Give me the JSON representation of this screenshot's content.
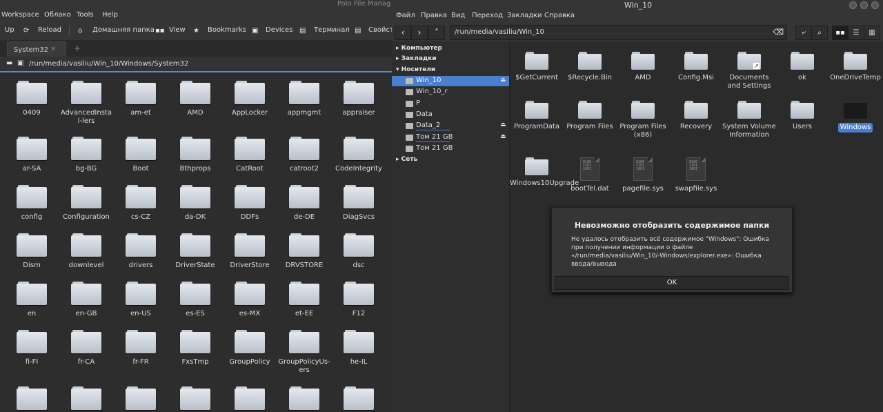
{
  "left_window": {
    "title": "Polo File Manag",
    "menu": [
      "Workspace",
      "Облако",
      "Tools",
      "Help"
    ],
    "toolbar": {
      "up": "Up",
      "reload": "Reload",
      "home": "Домашняя папка",
      "view": "View",
      "bookmarks": "Bookmarks",
      "devices": "Devices",
      "terminal": "Терминал",
      "properties": "Свойст"
    },
    "tab": {
      "label": "System32",
      "close": "✕",
      "new": "+"
    },
    "path": "/run/media/vasiliu/Win_10/Windows/System32",
    "folders": [
      "0409",
      "AdvancedInstal-lers",
      "am-et",
      "AMD",
      "AppLocker",
      "appmgmt",
      "appraiser",
      "ar-SA",
      "bg-BG",
      "Boot",
      "Bthprops",
      "CatRoot",
      "catroot2",
      "CodeIntegrity",
      "config",
      "Configuration",
      "cs-CZ",
      "da-DK",
      "DDFs",
      "de-DE",
      "DiagSvcs",
      "Dism",
      "downlevel",
      "drivers",
      "DriverState",
      "DriverStore",
      "DRVSTORE",
      "dsc",
      "en",
      "en-GB",
      "en-US",
      "es-ES",
      "es-MX",
      "et-EE",
      "F12",
      "fi-FI",
      "fr-CA",
      "fr-FR",
      "FxsTmp",
      "GroupPolicy",
      "GroupPolicyUs-ers",
      "he-IL",
      "",
      "",
      "",
      "",
      "",
      "",
      ""
    ]
  },
  "right_window": {
    "title": "Win_10",
    "menu": [
      "Файл",
      "Правка",
      "Вид",
      "Переход",
      "Закладки",
      "Справка"
    ],
    "location": "/run/media/vasiliu/Win_10",
    "sidebar": {
      "computer": "Компьютер",
      "bookmarks": "Закладки",
      "devices_header": "Носители",
      "devices": [
        {
          "label": "Win_10",
          "eject": true,
          "selected": true
        },
        {
          "label": "Win_10_r",
          "eject": false,
          "selected": false
        },
        {
          "label": "P",
          "eject": false,
          "selected": false
        },
        {
          "label": "Data",
          "eject": false,
          "selected": false
        },
        {
          "label": "Data_2",
          "eject": true,
          "selected": false
        },
        {
          "label": "Том 21 GB",
          "eject": true,
          "selected": false
        },
        {
          "label": "Том 21 GB",
          "eject": false,
          "selected": false
        }
      ],
      "network": "Сеть"
    },
    "items": [
      {
        "name": "$GetCurrent",
        "kind": "folder"
      },
      {
        "name": "$Recycle.Bin",
        "kind": "folder"
      },
      {
        "name": "AMD",
        "kind": "folder"
      },
      {
        "name": "Config.Msi",
        "kind": "folder"
      },
      {
        "name": "Documents and Settings",
        "kind": "link"
      },
      {
        "name": "ok",
        "kind": "folder"
      },
      {
        "name": "OneDriveTemp",
        "kind": "folder"
      },
      {
        "name": "ProgramData",
        "kind": "folder"
      },
      {
        "name": "Program Files",
        "kind": "folder"
      },
      {
        "name": "Program Files (x86)",
        "kind": "folder"
      },
      {
        "name": "Recovery",
        "kind": "folder"
      },
      {
        "name": "System Volume Information",
        "kind": "folder"
      },
      {
        "name": "Users",
        "kind": "folder"
      },
      {
        "name": "Windows",
        "kind": "selected"
      },
      {
        "name": "Windows10Upgrade",
        "kind": "folder"
      },
      {
        "name": "bootTel.dat",
        "kind": "file"
      },
      {
        "name": "pagefile.sys",
        "kind": "file"
      },
      {
        "name": "swapfile.sys",
        "kind": "file"
      }
    ],
    "dialog": {
      "title": "Невозможно отобразить содержимое папки",
      "message": "Не удалось отобразить всё содержимое \"Windows\": Ошибка при получении информации о файле «/run/media/vasiliu/Win_10/-Windows/explorer.exe»: Ошибка ввода/вывода",
      "ok": "OK"
    }
  }
}
